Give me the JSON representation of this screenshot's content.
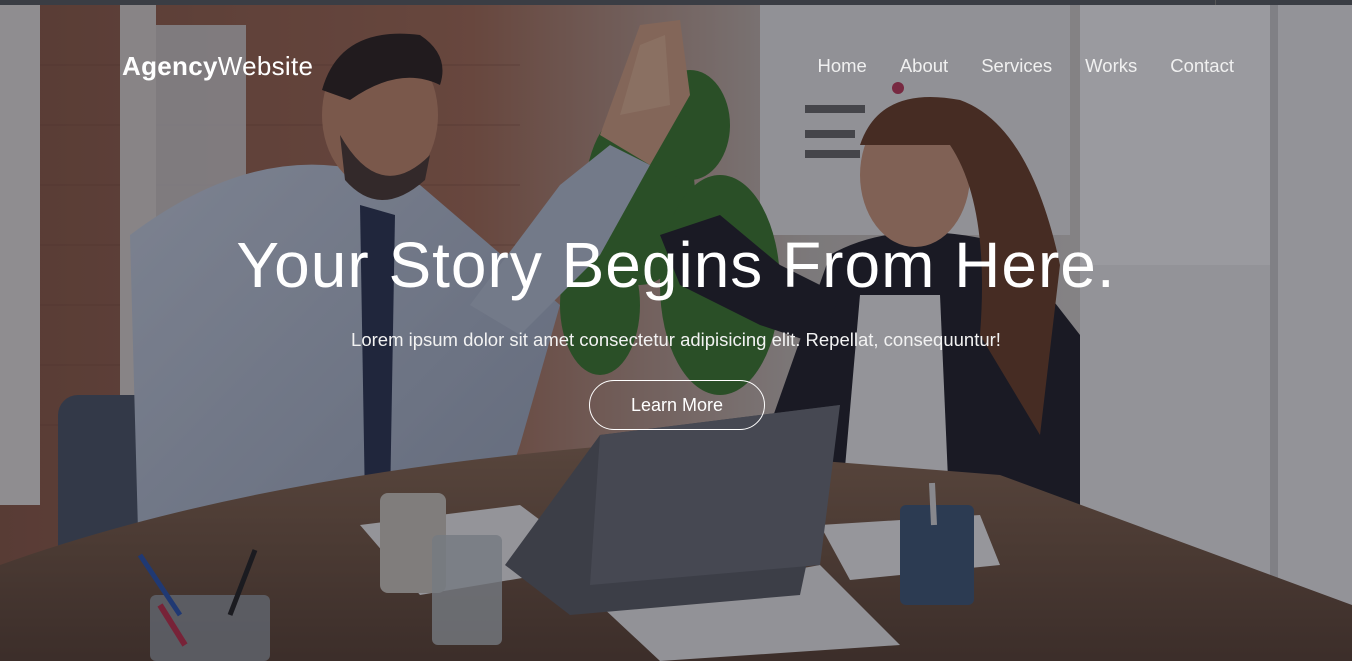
{
  "header": {
    "logo_bold": "Agency",
    "logo_light": "Website"
  },
  "nav": {
    "items": [
      "Home",
      "About",
      "Services",
      "Works",
      "Contact"
    ]
  },
  "hero": {
    "title": "Your Story Begins From Here.",
    "subtitle": "Lorem ipsum dolor sit amet consectetur adipisicing elit. Repellat, consequuntur!",
    "cta_label": "Learn More"
  },
  "colors": {
    "text": "#ffffff",
    "overlay": "#12121e"
  }
}
